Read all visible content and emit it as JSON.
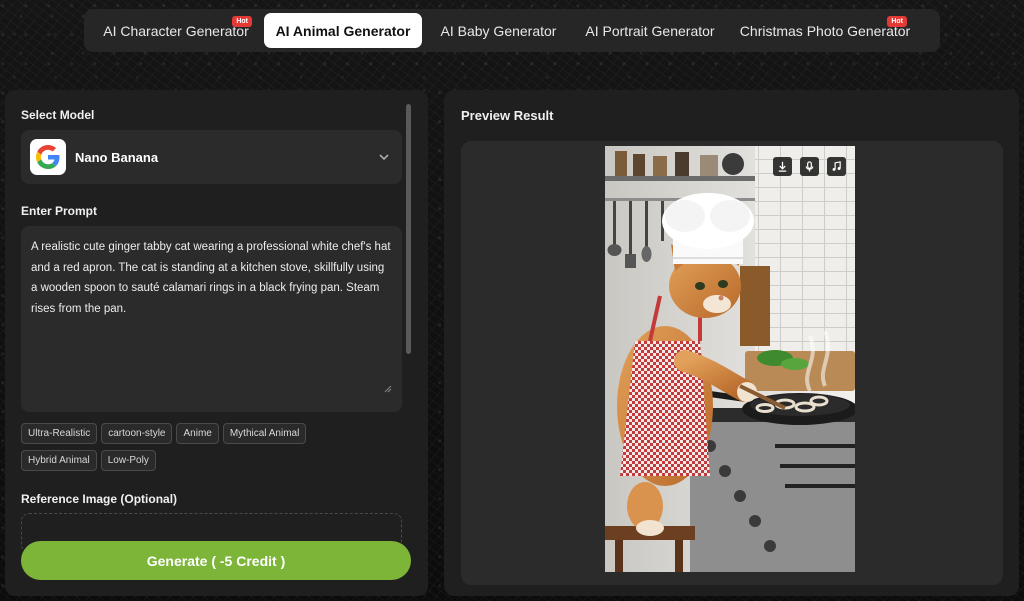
{
  "tabs": [
    {
      "label": "AI Character Generator",
      "badge": "Hot",
      "active": false
    },
    {
      "label": "AI Animal Generator",
      "badge": "",
      "active": true
    },
    {
      "label": "AI Baby Generator",
      "badge": "",
      "active": false
    },
    {
      "label": "AI Portrait Generator",
      "badge": "",
      "active": false
    },
    {
      "label": "Christmas Photo Generator",
      "badge": "Hot",
      "active": false
    }
  ],
  "left": {
    "select_model_label": "Select Model",
    "model": {
      "name": "Nano Banana",
      "icon": "google-logo-icon"
    },
    "prompt_label": "Enter Prompt",
    "prompt_value": "A realistic cute ginger tabby cat wearing a professional white chef's hat and a red apron. The cat is standing at a kitchen stove, skillfully using a wooden spoon to sauté calamari rings in a black frying pan. Steam rises from the pan.",
    "style_chips": [
      "Ultra-Realistic",
      "cartoon-style",
      "Anime",
      "Mythical Animal",
      "Hybrid Animal",
      "Low-Poly"
    ],
    "reference_label": "Reference Image (Optional)",
    "generate_label": "Generate ( -5 Credit )"
  },
  "right": {
    "preview_title": "Preview Result",
    "image_alt": "Ginger tabby cat in chef hat and red checkered apron cooking calamari in a frying pan at a kitchen stove",
    "actions": [
      "download-icon",
      "microphone-icon",
      "music-note-icon"
    ]
  },
  "colors": {
    "accent_green": "#7cb538",
    "hot_badge": "#e53935",
    "panel_bg": "#1f1f1f",
    "field_bg": "#2b2b2b"
  }
}
